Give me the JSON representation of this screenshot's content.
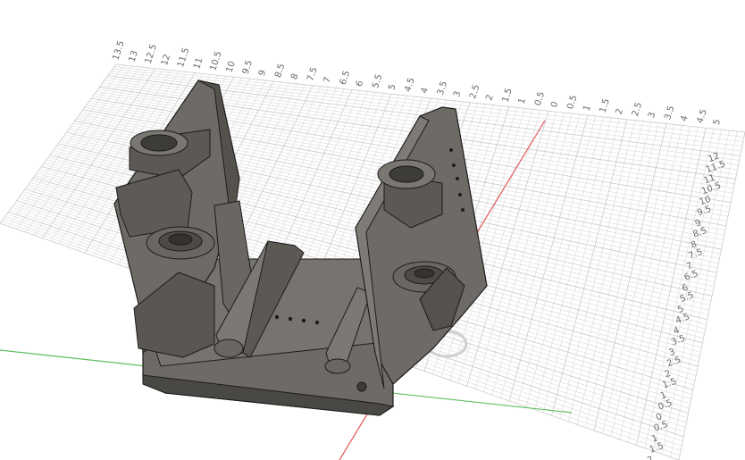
{
  "colors": {
    "background": "#ffffff",
    "grid_minor": "#e2e2e2",
    "grid_major": "#c9c9c9",
    "x_axis": "#e05555",
    "y_axis": "#5fbf5f",
    "part_face": "#6e6b66",
    "part_dark": "#4a4844",
    "part_light": "#8a8780",
    "edge": "#1c1c1c"
  },
  "rulers": {
    "back_edge_labels": [
      "13.5",
      "13",
      "12.5",
      "12",
      "11.5",
      "11",
      "10.5",
      "10",
      "9.5",
      "9",
      "8.5",
      "8",
      "7.5",
      "7",
      "6.5",
      "6",
      "5.5",
      "5",
      "4.5",
      "4",
      "3.5",
      "3",
      "2.5",
      "2",
      "1.5",
      "1",
      "0.5",
      "0",
      "0.5",
      "1",
      "1.5",
      "2",
      "2.5",
      "3",
      "3.5",
      "4",
      "4.5",
      "5"
    ],
    "right_edge_labels": [
      "12",
      "11.5",
      "11",
      "10.5",
      "10",
      "9.5",
      "9",
      "8.5",
      "8",
      "7.5",
      "7",
      "6.5",
      "6",
      "5.5",
      "5",
      "4.5",
      "4",
      "3.5",
      "3",
      "2.5",
      "2",
      "1.5",
      "1",
      "0.5",
      "0",
      "0.5",
      "1",
      "1.5",
      "2"
    ]
  },
  "model": {
    "icon": "3d-bracket-model"
  }
}
